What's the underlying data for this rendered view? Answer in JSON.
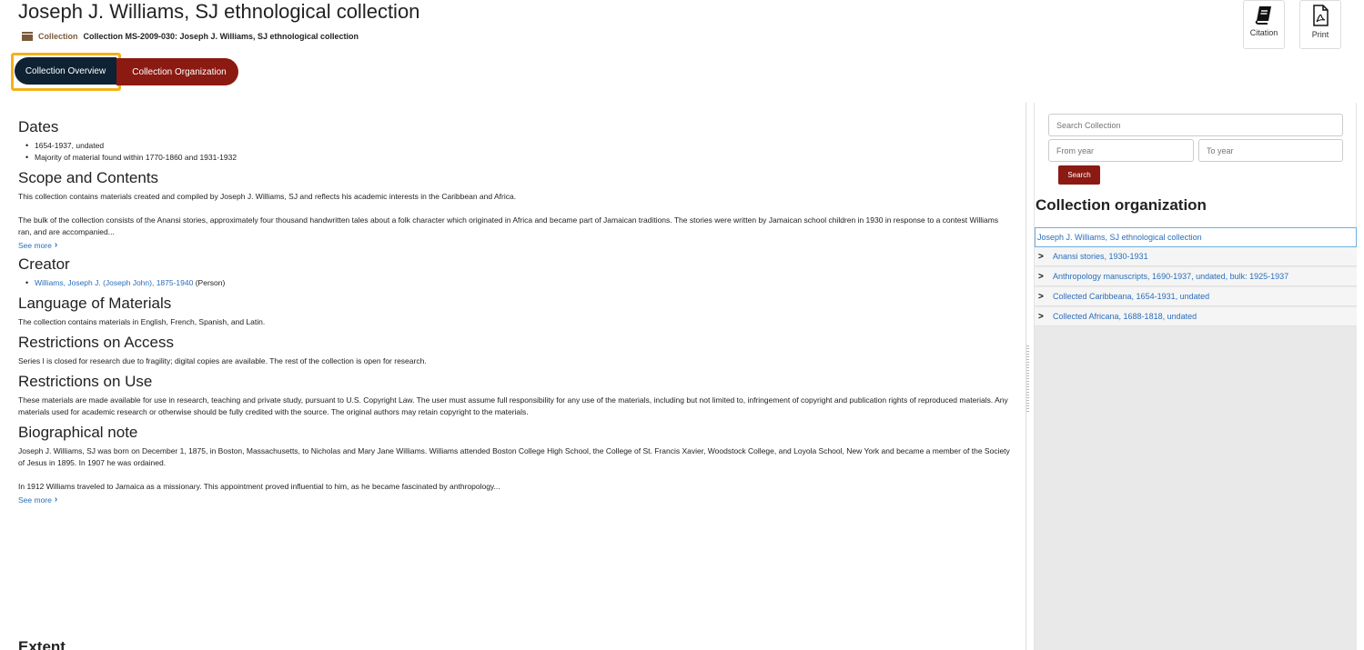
{
  "header": {
    "title": "Joseph J. Williams, SJ ethnological collection",
    "type_label": "Collection",
    "breadcrumb": "Collection MS-2009-030: Joseph J. Williams, SJ ethnological collection",
    "citation_label": "Citation",
    "print_label": "Print"
  },
  "tabs": {
    "overview": "Collection Overview",
    "organization": "Collection Organization"
  },
  "sections": {
    "dates": {
      "heading": "Dates",
      "items": [
        "1654-1937, undated",
        "Majority of material found within 1770-1860 and 1931-1932"
      ]
    },
    "scope": {
      "heading": "Scope and Contents",
      "p1": "This collection contains materials created and compiled by Joseph J. Williams, SJ and reflects his academic interests in the Caribbean and Africa.",
      "p2": "The bulk of the collection consists of the Anansi stories, approximately four thousand handwritten tales about a folk character which originated in Africa and became part of Jamaican traditions. The stories were written by Jamaican school children in 1930 in response to a contest Williams ran, and are accompanied...",
      "see_more": "See more"
    },
    "creator": {
      "heading": "Creator",
      "name": "Williams, Joseph J. (Joseph John), 1875-1940",
      "role": "(Person)"
    },
    "language": {
      "heading": "Language of Materials",
      "text": "The collection contains materials in English, French, Spanish, and Latin."
    },
    "access": {
      "heading": "Restrictions on Access",
      "text": "Series I is closed for research due to fragility; digital copies are available. The rest of the collection is open for research."
    },
    "use": {
      "heading": "Restrictions on Use",
      "text": "These materials are made available for use in research, teaching and private study, pursuant to U.S. Copyright Law. The user must assume full responsibility for any use of the materials, including but not limited to, infringement of copyright and publication rights of reproduced materials. Any materials used for academic research or otherwise should be fully credited with the source. The original authors may retain copyright to the materials."
    },
    "bio": {
      "heading": "Biographical note",
      "p1": "Joseph J. Williams, SJ was born on December 1, 1875, in Boston, Massachusetts, to Nicholas and Mary Jane Williams. Williams attended Boston College High School, the College of St. Francis Xavier, Woodstock College, and Loyola School, New York and became a member of the Society of Jesus in 1895. In 1907 he was ordained.",
      "p2": "In 1912 Williams traveled to Jamaica as a missionary. This appointment proved influential to him, as he became fascinated by anthropology...",
      "see_more": "See more"
    },
    "extent": {
      "heading": "Extent"
    }
  },
  "sidebar": {
    "search_placeholder": "Search Collection",
    "from_placeholder": "From year",
    "to_placeholder": "To year",
    "search_button": "Search",
    "org_heading": "Collection organization",
    "tree_root": "Joseph J. Williams, SJ ethnological collection",
    "tree_items": [
      "Anansi stories, 1930-1931",
      "Anthropology manuscripts, 1690-1937, undated, bulk: 1925-1937",
      "Collected Caribbeana, 1654-1931, undated",
      "Collected Africana, 1688-1818, undated"
    ]
  },
  "colors": {
    "accent_dark": "#0e2233",
    "accent_red": "#8b1a12",
    "highlight": "#f3b11b",
    "link": "#2a6ebb"
  }
}
